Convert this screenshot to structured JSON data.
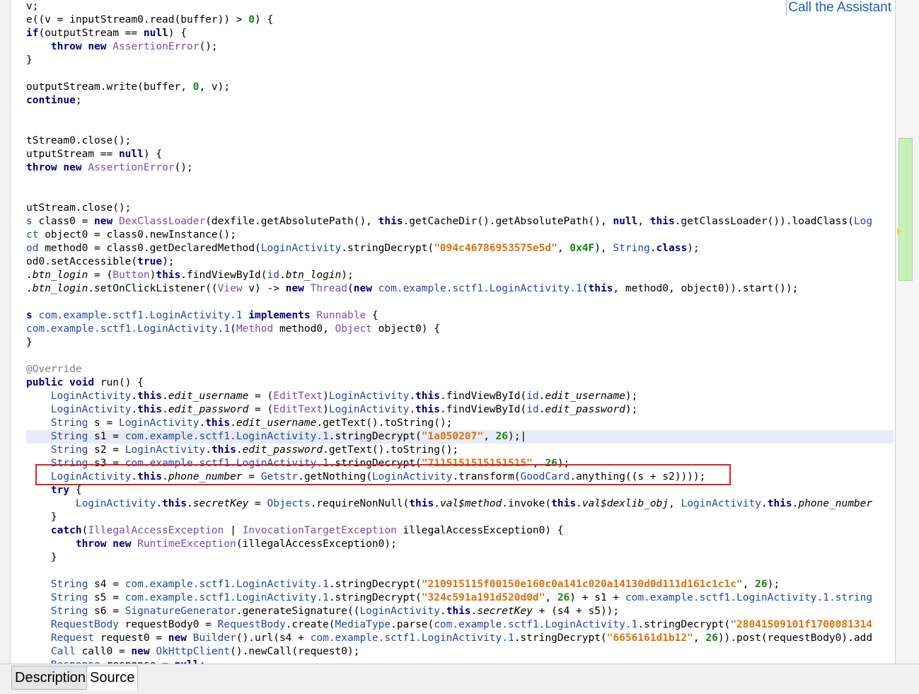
{
  "assistant_link": "Call the Assistant",
  "tabs": [
    {
      "label": "Description"
    },
    {
      "label": "Source"
    }
  ],
  "code_lines": [
    [
      [
        "v;",
        ""
      ]
    ],
    [
      [
        "e((v = inputStream0.read(buffer)) > ",
        ""
      ],
      [
        "0",
        "num"
      ],
      [
        ") {",
        ""
      ]
    ],
    [
      [
        "if",
        "kw"
      ],
      [
        "(outputStream == ",
        ""
      ],
      [
        "null",
        "kw"
      ],
      [
        ") {",
        ""
      ]
    ],
    [
      [
        "    ",
        ""
      ],
      [
        "throw",
        "kw"
      ],
      [
        " ",
        ""
      ],
      [
        "new",
        "kw"
      ],
      [
        " ",
        ""
      ],
      [
        "AssertionError",
        "ty"
      ],
      [
        "();",
        ""
      ]
    ],
    [
      [
        "}",
        ""
      ]
    ],
    [
      [
        "",
        ""
      ]
    ],
    [
      [
        "outputStream.write(buffer, ",
        ""
      ],
      [
        "0",
        "num"
      ],
      [
        ", v);",
        ""
      ]
    ],
    [
      [
        "continue",
        "kw"
      ],
      [
        ";",
        ""
      ]
    ],
    [
      [
        "",
        ""
      ]
    ],
    [
      [
        "",
        ""
      ]
    ],
    [
      [
        "tStream0.close();",
        ""
      ]
    ],
    [
      [
        "utputStream == ",
        ""
      ],
      [
        "null",
        "kw"
      ],
      [
        ") {",
        ""
      ]
    ],
    [
      [
        "throw",
        "kw"
      ],
      [
        " ",
        ""
      ],
      [
        "new",
        "kw"
      ],
      [
        " ",
        ""
      ],
      [
        "AssertionError",
        "ty"
      ],
      [
        "();",
        ""
      ]
    ],
    [
      [
        "",
        ""
      ]
    ],
    [
      [
        "",
        ""
      ]
    ],
    [
      [
        "utStream.close();",
        ""
      ]
    ],
    [
      [
        "s",
        "pk"
      ],
      [
        " class0 = ",
        ""
      ],
      [
        "new",
        "kw"
      ],
      [
        " ",
        ""
      ],
      [
        "DexClassLoader",
        "ty"
      ],
      [
        "(dexfile.getAbsolutePath(), ",
        ""
      ],
      [
        "this",
        "kw"
      ],
      [
        ".getCacheDir().getAbsolutePath(), ",
        ""
      ],
      [
        "null",
        "kw"
      ],
      [
        ", ",
        ""
      ],
      [
        "this",
        "kw"
      ],
      [
        ".getClassLoader()).loadClass(",
        ""
      ],
      [
        "Log",
        "pk"
      ]
    ],
    [
      [
        "ct",
        "pk"
      ],
      [
        " object0 = class0.newInstance();",
        ""
      ]
    ],
    [
      [
        "od",
        "pk"
      ],
      [
        " method0 = class0.getDeclaredMethod(",
        ""
      ],
      [
        "LoginActivity",
        "pk"
      ],
      [
        ".stringDecrypt(",
        ""
      ],
      [
        "\"094c46786953575e5d\"",
        "str"
      ],
      [
        ", ",
        ""
      ],
      [
        "0x4F",
        "num"
      ],
      [
        "), ",
        ""
      ],
      [
        "String",
        "pk"
      ],
      [
        ".",
        ""
      ],
      [
        "class",
        "kw"
      ],
      [
        ");",
        ""
      ]
    ],
    [
      [
        "od0.setAccessible(",
        ""
      ],
      [
        "true",
        "kw"
      ],
      [
        ");",
        ""
      ]
    ],
    [
      [
        ".",
        ""
      ],
      [
        "btn_login",
        "fl"
      ],
      [
        " = (",
        ""
      ],
      [
        "Button",
        "ty"
      ],
      [
        ")",
        ""
      ],
      [
        "this",
        "kw"
      ],
      [
        ".findViewById(",
        ""
      ],
      [
        "id",
        "pk"
      ],
      [
        ".",
        ""
      ],
      [
        "btn_login",
        "fl"
      ],
      [
        ");",
        ""
      ]
    ],
    [
      [
        ".",
        ""
      ],
      [
        "btn_login",
        "fl"
      ],
      [
        ".setOnClickListener((",
        ""
      ],
      [
        "View",
        "ty"
      ],
      [
        " v) -> ",
        ""
      ],
      [
        "new",
        "kw"
      ],
      [
        " ",
        ""
      ],
      [
        "Thread",
        "ty"
      ],
      [
        "(",
        ""
      ],
      [
        "new",
        "kw"
      ],
      [
        " ",
        ""
      ],
      [
        "com.example.sctf1.LoginActivity.1",
        "pk"
      ],
      [
        "(",
        ""
      ],
      [
        "this",
        "kw"
      ],
      [
        ", method0, object0)).start());",
        ""
      ]
    ],
    [
      [
        "",
        ""
      ]
    ],
    [
      [
        "s",
        "kw"
      ],
      [
        " ",
        ""
      ],
      [
        "com.example.sctf1.LoginActivity.1",
        "pk"
      ],
      [
        " ",
        ""
      ],
      [
        "implements",
        "kw"
      ],
      [
        " ",
        ""
      ],
      [
        "Runnable",
        "ty"
      ],
      [
        " {",
        ""
      ]
    ],
    [
      [
        "com.example.sctf1.LoginActivity.1",
        "pk"
      ],
      [
        "(",
        ""
      ],
      [
        "Method",
        "ty"
      ],
      [
        " method0, ",
        ""
      ],
      [
        "Object",
        "ty"
      ],
      [
        " object0) {",
        ""
      ]
    ],
    [
      [
        "}",
        ""
      ]
    ],
    [
      [
        "",
        ""
      ]
    ],
    [
      [
        "@Override",
        "an"
      ]
    ],
    [
      [
        "public",
        "kw"
      ],
      [
        " ",
        ""
      ],
      [
        "void",
        "kw"
      ],
      [
        " run() {",
        ""
      ]
    ],
    [
      [
        "    ",
        ""
      ],
      [
        "LoginActivity",
        "pk"
      ],
      [
        ".",
        ""
      ],
      [
        "this",
        "kw"
      ],
      [
        ".",
        ""
      ],
      [
        "edit_username",
        "fl"
      ],
      [
        " = (",
        ""
      ],
      [
        "EditText",
        "ty"
      ],
      [
        ")",
        ""
      ],
      [
        "LoginActivity",
        "pk"
      ],
      [
        ".",
        ""
      ],
      [
        "this",
        "kw"
      ],
      [
        ".findViewById(",
        ""
      ],
      [
        "id",
        "pk"
      ],
      [
        ".",
        ""
      ],
      [
        "edit_username",
        "fl"
      ],
      [
        ");",
        ""
      ]
    ],
    [
      [
        "    ",
        ""
      ],
      [
        "LoginActivity",
        "pk"
      ],
      [
        ".",
        ""
      ],
      [
        "this",
        "kw"
      ],
      [
        ".",
        ""
      ],
      [
        "edit_password",
        "fl"
      ],
      [
        " = (",
        ""
      ],
      [
        "EditText",
        "ty"
      ],
      [
        ")",
        ""
      ],
      [
        "LoginActivity",
        "pk"
      ],
      [
        ".",
        ""
      ],
      [
        "this",
        "kw"
      ],
      [
        ".findViewById(",
        ""
      ],
      [
        "id",
        "pk"
      ],
      [
        ".",
        ""
      ],
      [
        "edit_password",
        "fl"
      ],
      [
        ");",
        ""
      ]
    ],
    [
      [
        "    ",
        ""
      ],
      [
        "String",
        "pk"
      ],
      [
        " s = ",
        ""
      ],
      [
        "LoginActivity",
        "pk"
      ],
      [
        ".",
        ""
      ],
      [
        "this",
        "kw"
      ],
      [
        ".",
        ""
      ],
      [
        "edit_username",
        "fl"
      ],
      [
        ".getText().toString();",
        ""
      ]
    ],
    [
      [
        "    ",
        ""
      ],
      [
        "String",
        "pk"
      ],
      [
        " s1 = ",
        ""
      ],
      [
        "com.example.sctf1.LoginActivity.1",
        "pk"
      ],
      [
        ".stringDecrypt(",
        ""
      ],
      [
        "\"1a050207\"",
        "str"
      ],
      [
        ", ",
        ""
      ],
      [
        "26",
        "num"
      ],
      [
        ");|",
        ""
      ]
    ],
    [
      [
        "    ",
        ""
      ],
      [
        "String",
        "pk"
      ],
      [
        " s2 = ",
        ""
      ],
      [
        "LoginActivity",
        "pk"
      ],
      [
        ".",
        ""
      ],
      [
        "this",
        "kw"
      ],
      [
        ".",
        ""
      ],
      [
        "edit_password",
        "fl"
      ],
      [
        ".getText().toString();",
        ""
      ]
    ],
    [
      [
        "    ",
        ""
      ],
      [
        "String",
        "pk"
      ],
      [
        " s3 = ",
        ""
      ],
      [
        "com.example.sctf1.LoginActivity.1",
        "pk"
      ],
      [
        ".stringDecrypt(",
        ""
      ],
      [
        "\"7115151515151515\"",
        "str"
      ],
      [
        ", ",
        ""
      ],
      [
        "26",
        "num"
      ],
      [
        ");",
        ""
      ]
    ],
    [
      [
        "    ",
        ""
      ],
      [
        "LoginActivity",
        "pk"
      ],
      [
        ".",
        ""
      ],
      [
        "this",
        "kw"
      ],
      [
        ".",
        ""
      ],
      [
        "phone_number",
        "fl"
      ],
      [
        " = ",
        ""
      ],
      [
        "Getstr",
        "pk"
      ],
      [
        ".getNothing(",
        ""
      ],
      [
        "LoginActivity",
        "pk"
      ],
      [
        ".transform(",
        ""
      ],
      [
        "GoodCard",
        "pk"
      ],
      [
        ".anything((s + s2))));",
        ""
      ]
    ],
    [
      [
        "    ",
        ""
      ],
      [
        "try",
        "kw"
      ],
      [
        " {",
        ""
      ]
    ],
    [
      [
        "        ",
        ""
      ],
      [
        "LoginActivity",
        "pk"
      ],
      [
        ".",
        ""
      ],
      [
        "this",
        "kw"
      ],
      [
        ".",
        ""
      ],
      [
        "secretKey",
        "fl"
      ],
      [
        " = ",
        ""
      ],
      [
        "Objects",
        "pk"
      ],
      [
        ".requireNonNull(",
        ""
      ],
      [
        "this",
        "kw"
      ],
      [
        ".",
        ""
      ],
      [
        "val$method",
        "fl"
      ],
      [
        ".invoke(",
        ""
      ],
      [
        "this",
        "kw"
      ],
      [
        ".",
        ""
      ],
      [
        "val$dexlib_obj",
        "fl"
      ],
      [
        ", ",
        ""
      ],
      [
        "LoginActivity",
        "pk"
      ],
      [
        ".",
        ""
      ],
      [
        "this",
        "kw"
      ],
      [
        ".",
        ""
      ],
      [
        "phone_number",
        "fl"
      ]
    ],
    [
      [
        "    }",
        ""
      ]
    ],
    [
      [
        "    ",
        ""
      ],
      [
        "catch",
        "kw"
      ],
      [
        "(",
        ""
      ],
      [
        "IllegalAccessException",
        "ty"
      ],
      [
        " | ",
        ""
      ],
      [
        "InvocationTargetException",
        "ty"
      ],
      [
        " illegalAccessException0) {",
        ""
      ]
    ],
    [
      [
        "        ",
        ""
      ],
      [
        "throw",
        "kw"
      ],
      [
        " ",
        ""
      ],
      [
        "new",
        "kw"
      ],
      [
        " ",
        ""
      ],
      [
        "RuntimeException",
        "ty"
      ],
      [
        "(illegalAccessException0);",
        ""
      ]
    ],
    [
      [
        "    }",
        ""
      ]
    ],
    [
      [
        "",
        ""
      ]
    ],
    [
      [
        "    ",
        ""
      ],
      [
        "String",
        "pk"
      ],
      [
        " s4 = ",
        ""
      ],
      [
        "com.example.sctf1.LoginActivity.1",
        "pk"
      ],
      [
        ".stringDecrypt(",
        ""
      ],
      [
        "\"210915115f00150e160c0a141c020a14130d0d111d161c1c1c\"",
        "str"
      ],
      [
        ", ",
        ""
      ],
      [
        "26",
        "num"
      ],
      [
        ");",
        ""
      ]
    ],
    [
      [
        "    ",
        ""
      ],
      [
        "String",
        "pk"
      ],
      [
        " s5 = ",
        ""
      ],
      [
        "com.example.sctf1.LoginActivity.1",
        "pk"
      ],
      [
        ".stringDecrypt(",
        ""
      ],
      [
        "\"324c591a191d520d0d\"",
        "str"
      ],
      [
        ", ",
        ""
      ],
      [
        "26",
        "num"
      ],
      [
        ") + s1 + ",
        ""
      ],
      [
        "com.example.sctf1.LoginActivity.1",
        "pk"
      ],
      [
        ".string",
        "pk"
      ]
    ],
    [
      [
        "    ",
        ""
      ],
      [
        "String",
        "pk"
      ],
      [
        " s6 = ",
        ""
      ],
      [
        "SignatureGenerator",
        "pk"
      ],
      [
        ".generateSignature((",
        ""
      ],
      [
        "LoginActivity",
        "pk"
      ],
      [
        ".",
        ""
      ],
      [
        "this",
        "kw"
      ],
      [
        ".",
        ""
      ],
      [
        "secretKey",
        "fl"
      ],
      [
        " + (s4 + s5));",
        ""
      ]
    ],
    [
      [
        "    ",
        ""
      ],
      [
        "RequestBody",
        "pk"
      ],
      [
        " requestBody0 = ",
        ""
      ],
      [
        "RequestBody",
        "pk"
      ],
      [
        ".create(",
        ""
      ],
      [
        "MediaType",
        "pk"
      ],
      [
        ".parse(",
        ""
      ],
      [
        "com.example.sctf1.LoginActivity.1",
        "pk"
      ],
      [
        ".stringDecrypt(",
        ""
      ],
      [
        "\"28041509101f1700081314",
        "str"
      ]
    ],
    [
      [
        "    ",
        ""
      ],
      [
        "Request",
        "pk"
      ],
      [
        " request0 = ",
        ""
      ],
      [
        "new",
        "kw"
      ],
      [
        " ",
        ""
      ],
      [
        "Builder",
        "pk"
      ],
      [
        "().url(s4 + ",
        ""
      ],
      [
        "com.example.sctf1.LoginActivity.1",
        "pk"
      ],
      [
        ".stringDecrypt(",
        ""
      ],
      [
        "\"6656161d1b12\"",
        "str"
      ],
      [
        ", ",
        ""
      ],
      [
        "26",
        "num"
      ],
      [
        ")).post(requestBody0).add",
        ""
      ]
    ],
    [
      [
        "    ",
        ""
      ],
      [
        "Call",
        "pk"
      ],
      [
        " call0 = ",
        ""
      ],
      [
        "new",
        "kw"
      ],
      [
        " ",
        ""
      ],
      [
        "OkHttpClient",
        "pk"
      ],
      [
        "().newCall(request0);",
        ""
      ]
    ],
    [
      [
        "    ",
        ""
      ],
      [
        "Response",
        "pk"
      ],
      [
        " response = ",
        ""
      ],
      [
        "null",
        "kw"
      ],
      [
        ";",
        ""
      ]
    ]
  ],
  "highlighted_line": 32
}
